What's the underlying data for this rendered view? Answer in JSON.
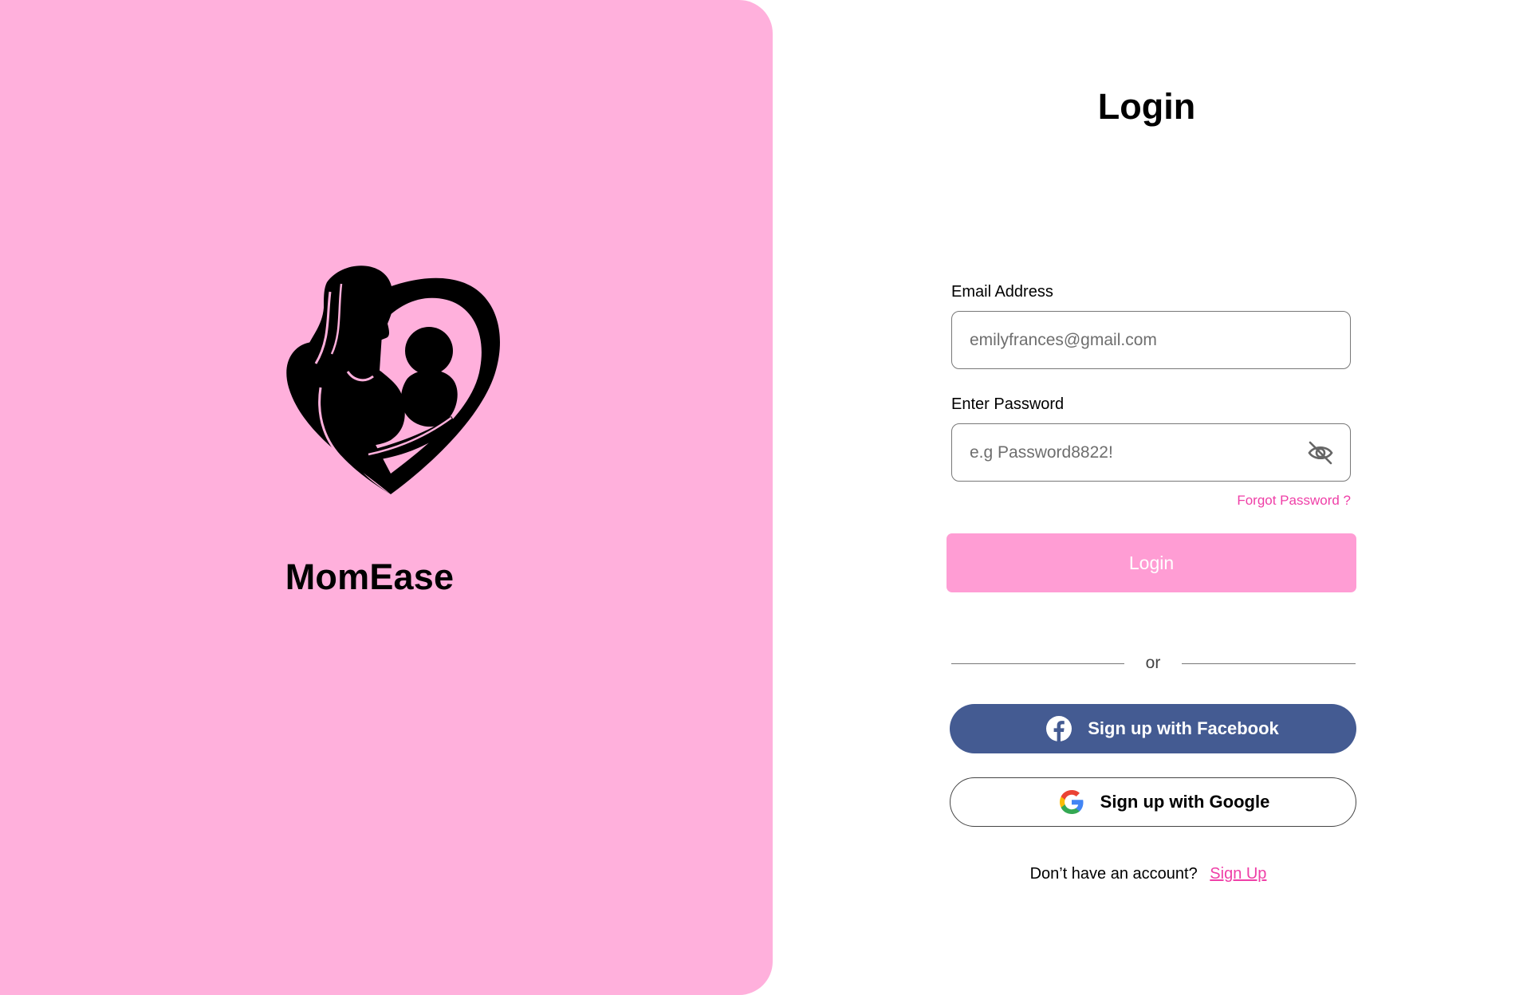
{
  "brand": {
    "name": "MomEase",
    "logo_icon": "mother-baby-heart-icon",
    "panel_color": "#ffb0dc"
  },
  "login": {
    "title": "Login",
    "email": {
      "label": "Email Address",
      "value": "",
      "placeholder": "emilyfrances@gmail.com"
    },
    "password": {
      "label": "Enter Password",
      "value": "",
      "placeholder": "e.g Password8822!",
      "toggle_icon": "eye-off-icon"
    },
    "forgot_password_label": "Forgot Password ?",
    "submit_label": "Login",
    "submit_color": "#ff9dd4",
    "divider_label": "or",
    "facebook_label": "Sign up with Facebook",
    "facebook_color": "#445b92",
    "google_label": "Sign up with Google",
    "signup_prompt": "Don’t have an account?",
    "signup_link_label": "Sign Up",
    "accent_color": "#ef3fa7"
  }
}
